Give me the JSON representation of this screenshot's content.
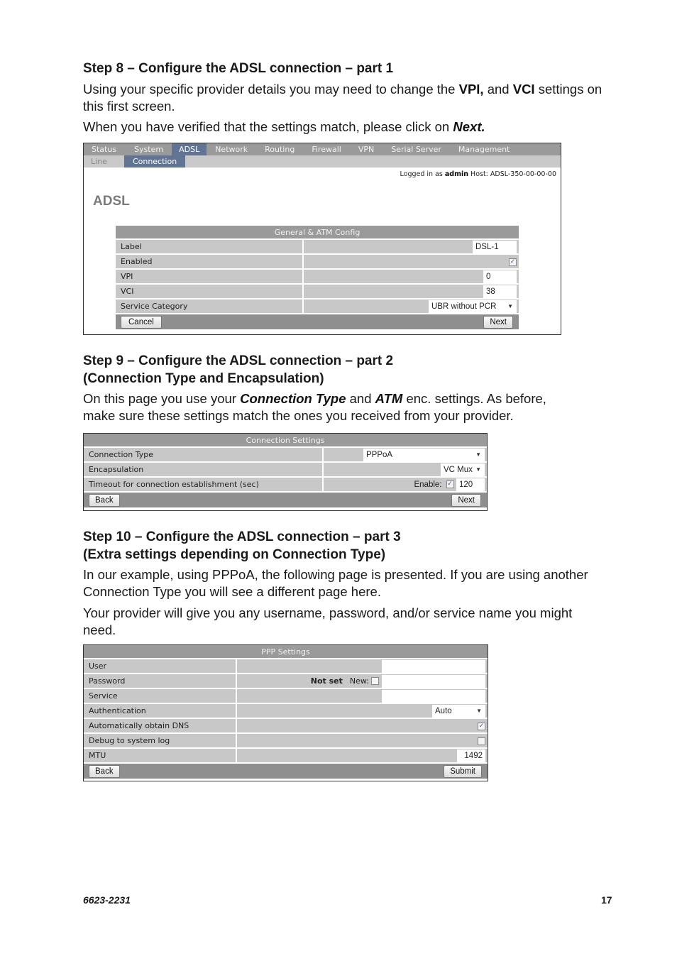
{
  "step8": {
    "heading": "Step 8 – Configure the ADSL connection – part 1",
    "para1_before": "Using your specific provider details you may need to change the ",
    "para1_vpi": "VPI,",
    "para1_mid": " and ",
    "para1_vci": "VCI",
    "para1_after": " settings on this first screen.",
    "para2_before": "When you have verified that the settings match, please click on ",
    "para2_next": "Next."
  },
  "adsl_screen": {
    "nav_tabs": [
      "Status",
      "System",
      "ADSL",
      "Network",
      "Routing",
      "Firewall",
      "VPN",
      "Serial Server",
      "Management"
    ],
    "active_tab": "ADSL",
    "subnav_tabs": [
      "Line",
      "Connection"
    ],
    "active_subtab": "Connection",
    "logged_in_prefix": "Logged in as ",
    "logged_in_user": "admin",
    "host_label": " Host: ",
    "host_value": "ADSL-350-00-00-00",
    "page_title": "ADSL",
    "table_title": "General & ATM Config",
    "rows": {
      "label": {
        "label": "Label",
        "value": "DSL-1"
      },
      "enabled": {
        "label": "Enabled",
        "checked": true
      },
      "vpi": {
        "label": "VPI",
        "value": "0"
      },
      "vci": {
        "label": "VCI",
        "value": "38"
      },
      "service_category": {
        "label": "Service Category",
        "value": "UBR without PCR"
      }
    },
    "cancel_label": "Cancel",
    "next_label": "Next"
  },
  "step9": {
    "heading_line1": "Step 9 – Configure the ADSL connection – part 2",
    "heading_line2": "(Connection Type and Encapsulation)",
    "para_a": "On this page you use your ",
    "para_conn": "Connection Type",
    "para_b": " and ",
    "para_atm": "ATM",
    "para_c": " enc. settings. As before, make sure these settings match the ones you received from your provider."
  },
  "connection_screen": {
    "table_title": "Connection Settings",
    "connection_type": {
      "label": "Connection Type",
      "value": "PPPoA"
    },
    "encapsulation": {
      "label": "Encapsulation",
      "value": "VC Mux"
    },
    "timeout": {
      "label": "Timeout for connection establishment (sec)",
      "enable_label": "Enable:",
      "enabled": true,
      "value": "120"
    },
    "back_label": "Back",
    "next_label": "Next"
  },
  "step10": {
    "heading_line1": "Step 10 – Configure the ADSL connection – part 3",
    "heading_line2": "(Extra settings depending on Connection Type)",
    "para1": "In our example, using PPPoA, the following page is presented. If you are using another Connection Type you will see a different page here.",
    "para2": "Your provider will give you any username, password, and/or service name you might need."
  },
  "ppp_screen": {
    "table_title": "PPP Settings",
    "user": {
      "label": "User",
      "value": ""
    },
    "password": {
      "label": "Password",
      "status": "Not set",
      "new_label": "New:",
      "new_checked": false,
      "value": ""
    },
    "service": {
      "label": "Service",
      "value": ""
    },
    "authentication": {
      "label": "Authentication",
      "value": "Auto"
    },
    "auto_dns": {
      "label": "Automatically obtain DNS",
      "checked": true
    },
    "debug_log": {
      "label": "Debug to system log",
      "checked": false
    },
    "mtu": {
      "label": "MTU",
      "value": "1492"
    },
    "back_label": "Back",
    "submit_label": "Submit"
  },
  "footer": {
    "doc_number": "6623-2231",
    "page_number": "17"
  }
}
